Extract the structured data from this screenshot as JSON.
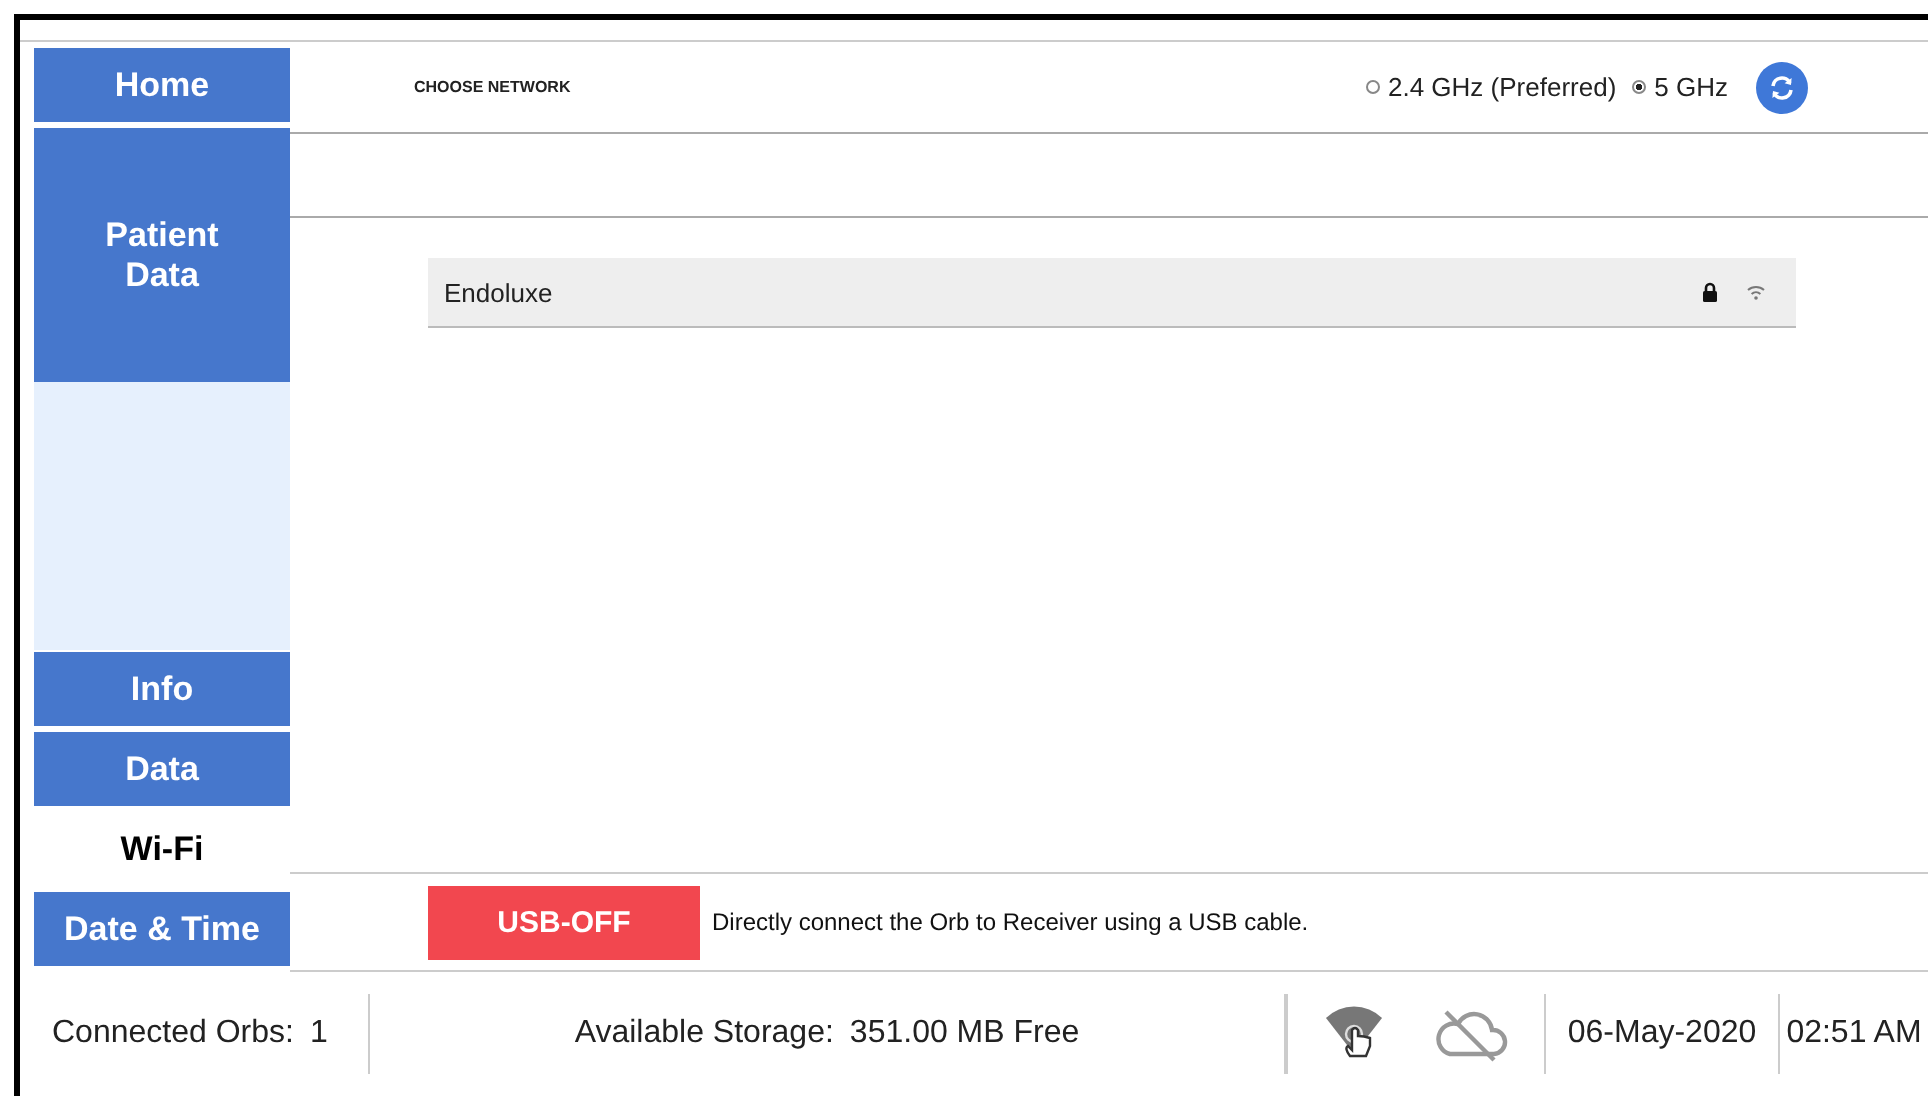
{
  "sidebar": {
    "top": [
      {
        "label": "Home",
        "selected": false
      },
      {
        "label": "Patient Data",
        "selected": false
      }
    ],
    "bottom": [
      {
        "label": "Info",
        "selected": false
      },
      {
        "label": "Data",
        "selected": false
      },
      {
        "label": "Wi-Fi",
        "selected": true
      },
      {
        "label": "Date & Time",
        "selected": false
      }
    ]
  },
  "network": {
    "title": "CHOOSE NETWORK",
    "bands": [
      {
        "label": "2.4 GHz (Preferred)",
        "selected": false
      },
      {
        "label": "5 GHz",
        "selected": true
      }
    ],
    "list": [
      {
        "name": "Endoluxe",
        "locked": true
      }
    ]
  },
  "usb": {
    "button": "USB-OFF",
    "description": "Directly connect the Orb to Receiver using a USB cable."
  },
  "status_bar": {
    "orbs_label": "Connected Orbs:",
    "orbs_value": "1",
    "storage_label": "Available Storage:",
    "storage_value": "351.00 MB Free",
    "date": "06-May-2020",
    "time": "02:51 AM"
  }
}
